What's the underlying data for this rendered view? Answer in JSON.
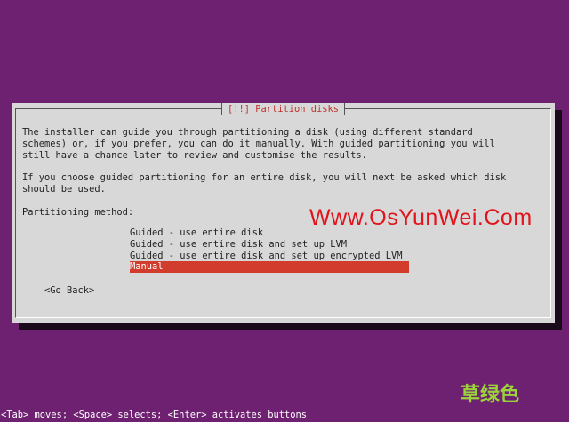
{
  "dialog": {
    "title": "[!!] Partition disks",
    "paragraph1": "The installer can guide you through partitioning a disk (using different standard\nschemes) or, if you prefer, you can do it manually. With guided partitioning you will\nstill have a chance later to review and customise the results.",
    "paragraph2": "If you choose guided partitioning for an entire disk, you will next be asked which disk\nshould be used.",
    "method_label": "Partitioning method:",
    "options": [
      {
        "label": "Guided - use entire disk",
        "selected": false
      },
      {
        "label": "Guided - use entire disk and set up LVM",
        "selected": false
      },
      {
        "label": "Guided - use entire disk and set up encrypted LVM",
        "selected": false
      },
      {
        "label": "Manual",
        "selected": true
      }
    ],
    "go_back_label": "<Go Back>"
  },
  "status_bar": {
    "text": "<Tab> moves; <Space> selects; <Enter> activates buttons"
  },
  "watermark": {
    "site": "Www.OsYunWei.Com",
    "signature": "草绿色"
  },
  "colors": {
    "background": "#6d2170",
    "dialog": "#d8d8d8",
    "title": "#c0322b",
    "selection": "#d13c2c",
    "watermark_site": "#e0141a",
    "watermark_signature": "#9ad43a"
  }
}
